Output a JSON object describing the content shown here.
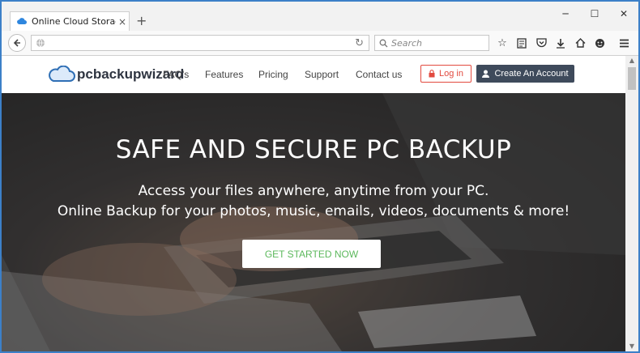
{
  "browser": {
    "tab_title": "Online Cloud Storage, Co...",
    "tab_close": "×",
    "new_tab": "+",
    "window_controls": [
      "─",
      "☐",
      "✕"
    ],
    "search_placeholder": "Search",
    "toolbar_icons": [
      "star-icon",
      "reading-list-icon",
      "pocket-icon",
      "download-icon",
      "home-icon",
      "chat-icon",
      "menu-icon"
    ]
  },
  "site": {
    "logo_text": "pcbackupwizard",
    "nav": [
      "FAQ's",
      "Features",
      "Pricing",
      "Support",
      "Contact us"
    ],
    "login_label": "Log in",
    "create_label": "Create An Account",
    "hero_title": "SAFE AND SECURE PC BACKUP",
    "hero_line1": "Access your files anywhere, anytime from your PC.",
    "hero_line2": "Online Backup for your photos, music, emails, videos, documents & more!",
    "cta_label": "GET STARTED NOW"
  },
  "colors": {
    "accent_red": "#e24a3f",
    "dark_button": "#3e4a5b",
    "cta_text": "#5cb85c",
    "window_border": "#3c80c8"
  }
}
